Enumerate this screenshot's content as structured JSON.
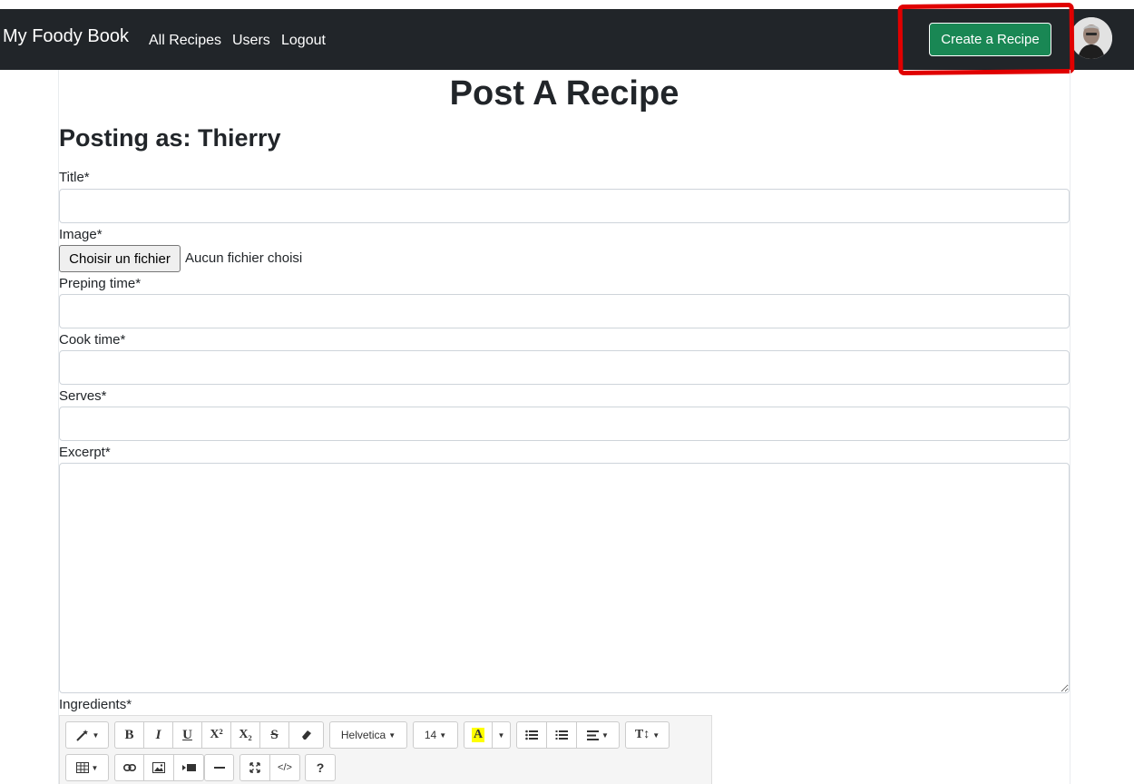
{
  "navbar": {
    "brand": "My Foody Book",
    "links": [
      "All Recipes",
      "Users",
      "Logout"
    ],
    "create_button": "Create a Recipe"
  },
  "page": {
    "title": "Post A Recipe",
    "posting_as": "Posting as: Thierry"
  },
  "form": {
    "title_label": "Title*",
    "image_label": "Image*",
    "file_button": "Choisir un fichier",
    "file_status": "Aucun fichier choisi",
    "prep_label": "Preping time*",
    "cook_label": "Cook time*",
    "serves_label": "Serves*",
    "excerpt_label": "Excerpt*",
    "ingredients_label": "Ingredients*"
  },
  "editor_toolbar": {
    "style_icon": "magic-wand-icon",
    "bold": "B",
    "italic": "I",
    "underline": "U",
    "superscript": "X²",
    "subscript": "X₂",
    "strikethrough": "S",
    "clear_icon": "eraser-icon",
    "font_family": "Helvetica",
    "font_size": "14",
    "color_letter": "A",
    "unordered_list_icon": "unordered-list-icon",
    "ordered_list_icon": "ordered-list-icon",
    "align_icon": "align-icon",
    "line_height_label": "T↕",
    "table_icon": "table-icon",
    "link_icon": "link-icon",
    "picture_icon": "picture-icon",
    "video_icon": "video-icon",
    "hr_icon": "horizontal-rule-icon",
    "fullscreen_icon": "fullscreen-icon",
    "code_view": "</>",
    "help": "?"
  },
  "colors": {
    "navbar_bg": "#212529",
    "create_button_bg": "#198754",
    "highlight_annotation": "#e00000",
    "color_swatch": "#ffff00"
  }
}
